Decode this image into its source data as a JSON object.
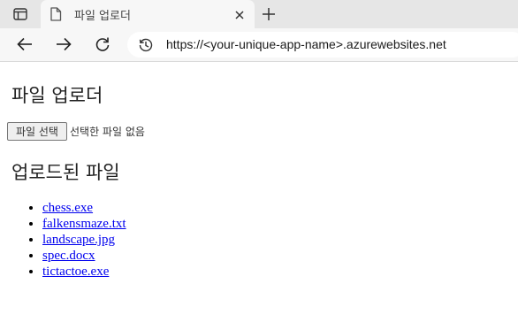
{
  "browser": {
    "tab_title": "파일 업로더",
    "address_url": "https://<your-unique-app-name>.azurewebsites.net"
  },
  "page": {
    "title": "파일 업로더",
    "file_button_label": "파일 선택",
    "file_status": "선택한 파일 없음",
    "uploaded_title": "업로드된 파일",
    "files": [
      "chess.exe",
      "falkensmaze.txt",
      "landscape.jpg",
      "spec.docx",
      "tictactoe.exe"
    ]
  }
}
